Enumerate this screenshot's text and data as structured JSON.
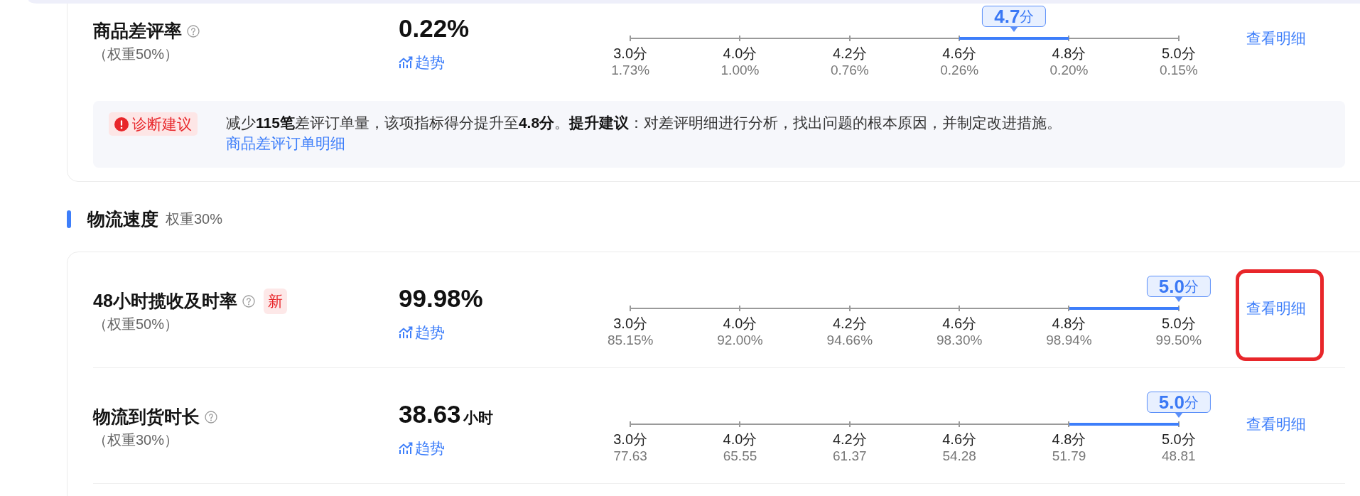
{
  "sections": [
    {
      "rows": [
        {
          "name": "商品差评率",
          "weight": "（权重50%）",
          "value": "0.22%",
          "trend": "趋势",
          "scale": {
            "score": "**4.7**分",
            "level": 0.7,
            "ticks": [
              {
                "label": "3.0分",
                "value": "1.73%"
              },
              {
                "label": "4.0分",
                "value": "1.00%"
              },
              {
                "label": "4.2分",
                "value": "0.76%"
              },
              {
                "label": "4.6分",
                "value": "0.26%"
              },
              {
                "label": "4.8分",
                "value": "0.20%"
              },
              {
                "label": "5.0分",
                "value": "0.15%"
              }
            ]
          },
          "detail_link": "查看明细",
          "highlighted": false
        }
      ],
      "diagnosis": {
        "tag": "诊断建议",
        "text": "减少**115笔**差评订单量，该项指标得分提升至**4.8分**。**提升建议**：对差评明细进行分析，找出问题的根本原因，并制定改进措施。",
        "link": "商品差评订单明细"
      }
    },
    {
      "title": "物流速度",
      "weight": "权重30%",
      "rows": [
        {
          "name": "48小时揽收及时率",
          "new_badge": "新",
          "weight": "（权重50%）",
          "value": "99.98%",
          "trend": "趋势",
          "scale": {
            "score": "**5.0**分",
            "level": 1,
            "ticks": [
              {
                "label": "3.0分",
                "value": "85.15%"
              },
              {
                "label": "4.0分",
                "value": "92.00%"
              },
              {
                "label": "4.2分",
                "value": "94.66%"
              },
              {
                "label": "4.6分",
                "value": "98.30%"
              },
              {
                "label": "4.8分",
                "value": "98.94%"
              },
              {
                "label": "5.0分",
                "value": "99.50%"
              }
            ]
          },
          "detail_link": "查看明细",
          "highlighted": true
        },
        {
          "name": "物流到货时长",
          "weight": "（权重30%）",
          "value": "38.63",
          "unit": "小时",
          "trend": "趋势",
          "scale": {
            "score": "**5.0**分",
            "level": 1,
            "ticks": [
              {
                "label": "3.0分",
                "value": "77.63"
              },
              {
                "label": "4.0分",
                "value": "65.55"
              },
              {
                "label": "4.2分",
                "value": "61.37"
              },
              {
                "label": "4.6分",
                "value": "54.28"
              },
              {
                "label": "4.8分",
                "value": "51.79"
              },
              {
                "label": "5.0分",
                "value": "48.81"
              }
            ]
          },
          "detail_link": "查看明细",
          "highlighted": false
        }
      ]
    }
  ]
}
